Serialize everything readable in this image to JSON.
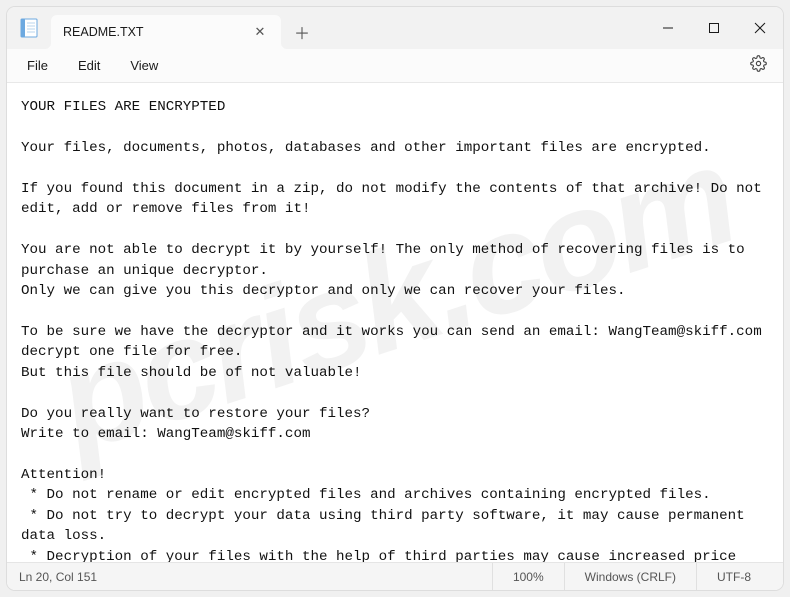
{
  "titlebar": {
    "tab_title": "README.TXT"
  },
  "menubar": {
    "file": "File",
    "edit": "Edit",
    "view": "View"
  },
  "content": {
    "text": "YOUR FILES ARE ENCRYPTED\n\nYour files, documents, photos, databases and other important files are encrypted.\n\nIf you found this document in a zip, do not modify the contents of that archive! Do not edit, add or remove files from it!\n\nYou are not able to decrypt it by yourself! The only method of recovering files is to purchase an unique decryptor.\nOnly we can give you this decryptor and only we can recover your files.\n\nTo be sure we have the decryptor and it works you can send an email: WangTeam@skiff.com decrypt one file for free.\nBut this file should be of not valuable!\n\nDo you really want to restore your files?\nWrite to email: WangTeam@skiff.com\n\nAttention!\n * Do not rename or edit encrypted files and archives containing encrypted files.\n * Do not try to decrypt your data using third party software, it may cause permanent data loss.\n * Decryption of your files with the help of third parties may cause increased price (they add their fee to our) or you can become a victim of a scam."
  },
  "statusbar": {
    "position": "Ln 20, Col 151",
    "zoom": "100%",
    "line_ending": "Windows (CRLF)",
    "encoding": "UTF-8"
  },
  "watermark": "pcrisk.com"
}
